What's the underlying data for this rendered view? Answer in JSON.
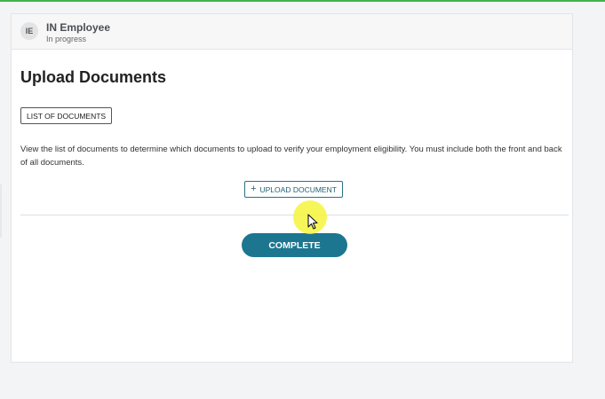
{
  "header": {
    "avatar_initials": "IE",
    "employee_name": "IN Employee",
    "status": "In progress"
  },
  "main": {
    "title": "Upload Documents",
    "list_button_label": "LIST OF DOCUMENTS",
    "description": "View the list of documents to determine which documents to upload to verify your employment eligibility. You must include both the front and back of all documents.",
    "upload_button_label": "UPLOAD DOCUMENT",
    "upload_icon": "plus-icon",
    "complete_button_label": "COMPLETE"
  },
  "colors": {
    "accent_green": "#3fb24a",
    "primary_teal": "#1d7690",
    "cursor_highlight": "#f6f43c"
  }
}
